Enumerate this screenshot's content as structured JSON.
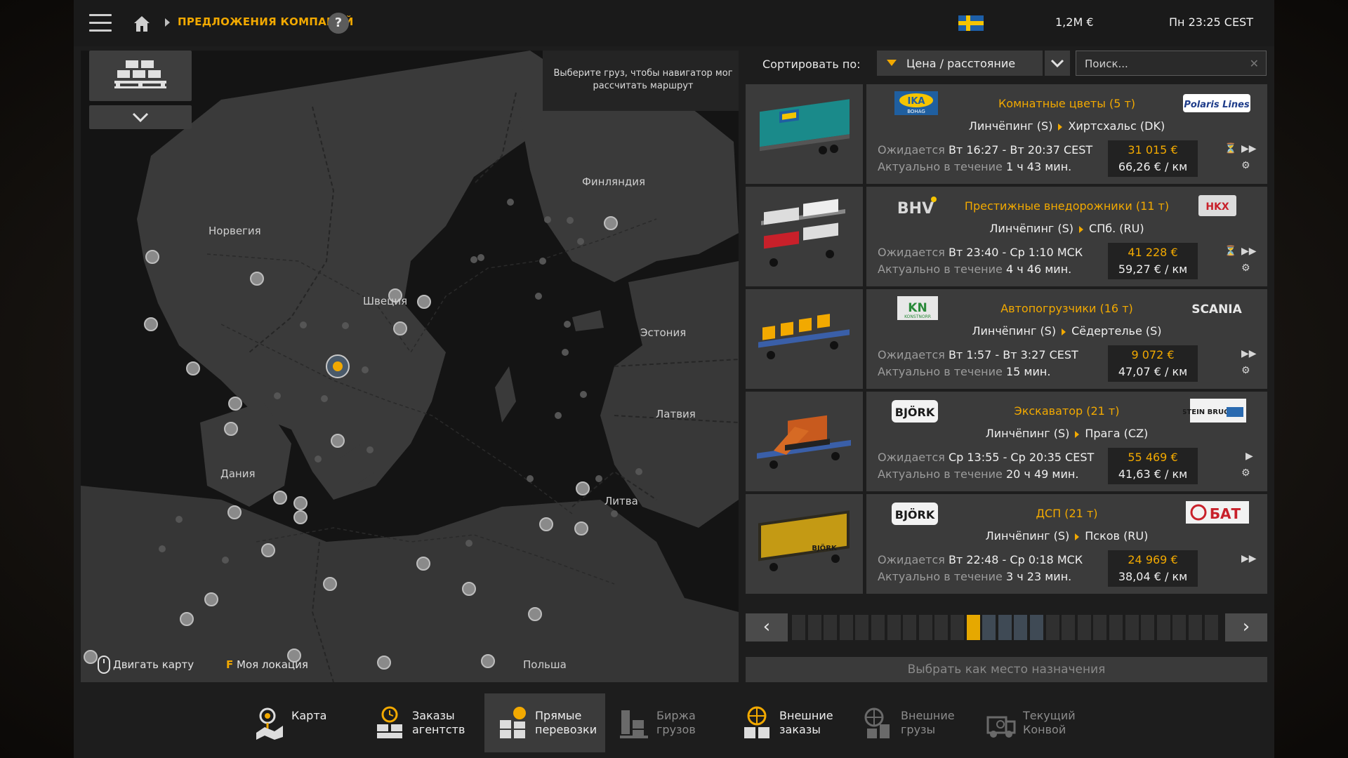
{
  "topbar": {
    "breadcrumb": "ПРЕДЛОЖЕНИЯ КОМПАНИЙ",
    "help": "?",
    "money": "1,2М  €",
    "clock": "Пн 23:25 CEST"
  },
  "map": {
    "hint": "Выберите груз, чтобы навигатор мог рассчитать маршрут",
    "countries": {
      "norway": "Норвегия",
      "sweden": "Швеция",
      "finland": "Финляндия",
      "estonia": "Эстония",
      "latvia": "Латвия",
      "lithuania": "Литва",
      "denmark": "Дания",
      "poland": "Польша"
    },
    "move_map": "Двигать карту",
    "my_location_key": "F",
    "my_location": "Моя локация"
  },
  "sort": {
    "label": "Сортировать по:",
    "value": "Цена / расстояние",
    "search_placeholder": "Поиск..."
  },
  "offers": [
    {
      "cargo": "Комнатные цветы (5 т)",
      "route_from": "Линчёпинг (S)",
      "route_to": "Хиртсхальс (DK)",
      "expect_label": "Ожидается",
      "expect_value": "Вт 16:27 - Вт 20:37 CEST",
      "valid_label": "Актуально в течение",
      "valid_value": "1 ч 43 мин.",
      "price": "31 015 €",
      "per_km": "66,26 € / км",
      "sender": "IKA",
      "sender_sub": "BOHAG",
      "receiver": "Polaris Lines"
    },
    {
      "cargo": "Престижные внедорожники (11 т)",
      "route_from": "Линчёпинг (S)",
      "route_to": "СПб. (RU)",
      "expect_label": "Ожидается",
      "expect_value": "Вт 23:40 - Ср 1:10 МСК",
      "valid_label": "Актуально в течение",
      "valid_value": "4 ч 46 мин.",
      "price": "41 228 €",
      "per_km": "59,27 € / км",
      "sender": "BHV",
      "receiver": "HKX"
    },
    {
      "cargo": "Автопогрузчики (16 т)",
      "route_from": "Линчёпинг (S)",
      "route_to": "Сёдертелье (S)",
      "expect_label": "Ожидается",
      "expect_value": "Вт 1:57 - Вт 3:27 CEST",
      "valid_label": "Актуально в течение",
      "valid_value": "15 мин.",
      "price": "9 072 €",
      "per_km": "47,07 € / км",
      "sender": "KN",
      "sender_sub": "KONSTNORR",
      "receiver": "SCANIA"
    },
    {
      "cargo": "Экскаватор (21 т)",
      "route_from": "Линчёпинг (S)",
      "route_to": "Прага (CZ)",
      "expect_label": "Ожидается",
      "expect_value": "Ср 13:55 - Ср 20:35 CEST",
      "valid_label": "Актуально в течение",
      "valid_value": "20 ч 49 мин.",
      "price": "55 469 €",
      "per_km": "41,63 € / км",
      "sender": "BJÖRK",
      "receiver": "STEIN BRUCH"
    },
    {
      "cargo": "ДСП (21 т)",
      "route_from": "Линчёпинг (S)",
      "route_to": "Псков (RU)",
      "expect_label": "Ожидается",
      "expect_value": "Вт 22:48 - Ср 0:18 МСК",
      "valid_label": "Актуально в течение",
      "valid_value": "3 ч 23 мин.",
      "price": "24 969 €",
      "per_km": "38,04 € / км",
      "sender": "BJÖRK",
      "receiver": "БАТ"
    }
  ],
  "pager": {
    "active_page": 12,
    "page_count": 27
  },
  "choose_destination": "Выбрать как место назначения",
  "nav": [
    {
      "line1": "Карта",
      "line2": "",
      "icon": "map-pin-icon"
    },
    {
      "line1": "Заказы",
      "line2": "агентств",
      "icon": "agency-clock-icon"
    },
    {
      "line1": "Прямые",
      "line2": "перевозки",
      "icon": "direct-cargo-icon"
    },
    {
      "line1": "Биржа",
      "line2": "грузов",
      "icon": "freight-market-icon"
    },
    {
      "line1": "Внешние",
      "line2": "заказы",
      "icon": "external-orders-globe-icon"
    },
    {
      "line1": "Внешние",
      "line2": "грузы",
      "icon": "external-cargo-globe-icon"
    },
    {
      "line1": "Текущий",
      "line2": "Конвой",
      "icon": "convoy-icon"
    }
  ],
  "colors": {
    "accent": "#f2a900",
    "panel": "#3b3b3b",
    "background": "#1d1d1d"
  }
}
